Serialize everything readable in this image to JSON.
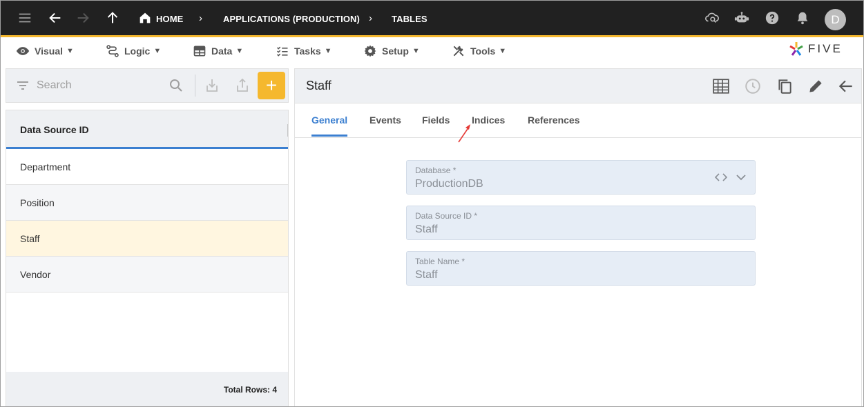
{
  "topbar": {
    "breadcrumbs": [
      "HOME",
      "APPLICATIONS (PRODUCTION)",
      "TABLES"
    ],
    "avatar_initial": "D",
    "accent_color": "#f5b82e",
    "icons": [
      "menu-icon",
      "back-arrow-icon",
      "forward-arrow-icon",
      "up-arrow-icon",
      "home-icon",
      "cloud-search-icon",
      "chatbot-icon",
      "help-icon",
      "bell-icon"
    ]
  },
  "menubar": {
    "items": [
      {
        "label": "Visual",
        "icon": "eye-icon"
      },
      {
        "label": "Logic",
        "icon": "logic-icon"
      },
      {
        "label": "Data",
        "icon": "table-icon"
      },
      {
        "label": "Tasks",
        "icon": "tasks-icon"
      },
      {
        "label": "Setup",
        "icon": "gear-icon"
      },
      {
        "label": "Tools",
        "icon": "tools-icon"
      }
    ],
    "caret": "▼",
    "logo_text": "FIVE"
  },
  "left": {
    "search_placeholder": "Search",
    "add_label": "+",
    "column_header": "Data Source ID",
    "rows": [
      "Department",
      "Position",
      "Staff",
      "Vendor"
    ],
    "selected_row": "Staff",
    "footer": "Total Rows: 4"
  },
  "right": {
    "title": "Staff",
    "tabs": [
      "General",
      "Events",
      "Fields",
      "Indices",
      "References"
    ],
    "active_tab": "General",
    "fields": [
      {
        "label": "Database *",
        "value": "ProductionDB"
      },
      {
        "label": "Data Source ID *",
        "value": "Staff"
      },
      {
        "label": "Table Name *",
        "value": "Staff"
      }
    ],
    "selection_color": "#fff6e0",
    "tab_color": "#3b7fd0"
  }
}
